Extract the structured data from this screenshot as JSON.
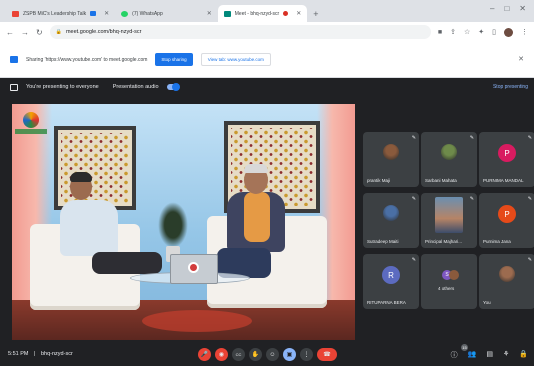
{
  "browser": {
    "tabs": [
      {
        "label": "ZSPB MiC's Leadership Talk",
        "fav_color": "#ea4335",
        "active": false
      },
      {
        "label": "(7) WhatsApp",
        "fav_color": "#25d366",
        "active": false
      },
      {
        "label": "Meet - bhq-nzyd-scr",
        "fav_color": "#00897b",
        "active": true
      }
    ],
    "new_tab": "+",
    "window_controls": [
      "–",
      "□",
      "✕"
    ],
    "url": "meet.google.com/bhq-nzyd-scr"
  },
  "share_bar": {
    "message": "Sharing 'https://www.youtube.com' to meet.google.com",
    "stop_sharing": "Stop sharing",
    "view_tab": "View tab: www.youtube.com",
    "close": "✕"
  },
  "presenting_bar": {
    "message": "You're presenting to everyone",
    "audio_label": "Presentation audio",
    "stop_presenting": "Stop presenting"
  },
  "main_video": {
    "watermark": "",
    "corner_logo_text": ""
  },
  "participants": [
    {
      "name": "prantik Maji",
      "type": "photo",
      "color": "#8a5a3c"
    },
    {
      "name": "Sarbani Mahata",
      "type": "photo",
      "color": "#6e8a4a"
    },
    {
      "name": "PURNIMA MANDAL",
      "type": "initial",
      "initial": "P",
      "color": "#d81b60"
    },
    {
      "name": "Sutradeep Maiti",
      "type": "photo",
      "color": "#4a6fa5"
    },
    {
      "name": "Principal Majhari...",
      "type": "video",
      "color": "#b68466"
    },
    {
      "name": "Purnima Jana",
      "type": "initial",
      "initial": "P",
      "color": "#e64a19"
    },
    {
      "name": "RITUPARNA BERA",
      "type": "initial",
      "initial": "R",
      "color": "#5c6bc0"
    },
    {
      "name": "4 others",
      "type": "group",
      "initial": "S",
      "color": "#7e57c2"
    },
    {
      "name": "You",
      "type": "photo",
      "color": "#9c6b4f"
    }
  ],
  "bottom": {
    "time": "5:51 PM",
    "separator": "|",
    "meeting_code": "bhq-nzyd-scr",
    "participant_count": "15",
    "controls": [
      {
        "name": "mic-off-icon",
        "glyph": "🎤",
        "style": "red"
      },
      {
        "name": "camera-off-icon",
        "glyph": "◉",
        "style": "red"
      },
      {
        "name": "captions-icon",
        "glyph": "CC",
        "style": ""
      },
      {
        "name": "raise-hand-icon",
        "glyph": "✋",
        "style": ""
      },
      {
        "name": "emoji-icon",
        "glyph": "☺",
        "style": ""
      },
      {
        "name": "present-icon",
        "glyph": "▣",
        "style": "blue"
      },
      {
        "name": "more-options-icon",
        "glyph": "⋮",
        "style": ""
      },
      {
        "name": "end-call-icon",
        "glyph": "☎",
        "style": "end"
      }
    ]
  }
}
